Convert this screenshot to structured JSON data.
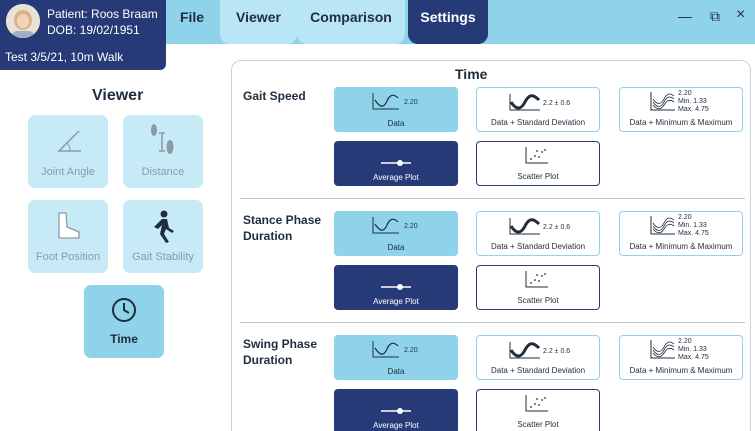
{
  "patient": {
    "name": "Patient: Roos Braam",
    "dob": "DOB: 19/02/1951",
    "test": "Test 3/5/21, 10m Walk"
  },
  "menu": {
    "file": "File",
    "viewer": "Viewer",
    "comparison": "Comparison",
    "settings": "Settings"
  },
  "window": {
    "minimize": "—",
    "restore": "⧉",
    "close": "×"
  },
  "viewer": {
    "title": "Viewer",
    "buttons": [
      "Joint Angle",
      "Distance",
      "Foot Position",
      "Gait Stability",
      "Time"
    ]
  },
  "time": {
    "title": "Time",
    "sections": [
      {
        "title": "Gait Speed"
      },
      {
        "title": "Stance Phase Duration"
      },
      {
        "title": "Swing Phase Duration"
      }
    ]
  },
  "options": {
    "data": "Data",
    "data_value": "2.20",
    "sd": "Data + Standard Deviation",
    "sd_value": "2.2 ± 0.6",
    "mm": "Data + Minimum & Maximum",
    "mm_value": "2.20",
    "mm_min": "Min. 1.33",
    "mm_max": "Max. 4.75",
    "avg": "Average Plot",
    "scatter": "Scatter Plot"
  },
  "colors": {
    "navy": "#263a78",
    "accent": "#8fd3ea",
    "light": "#c6ebf7"
  }
}
